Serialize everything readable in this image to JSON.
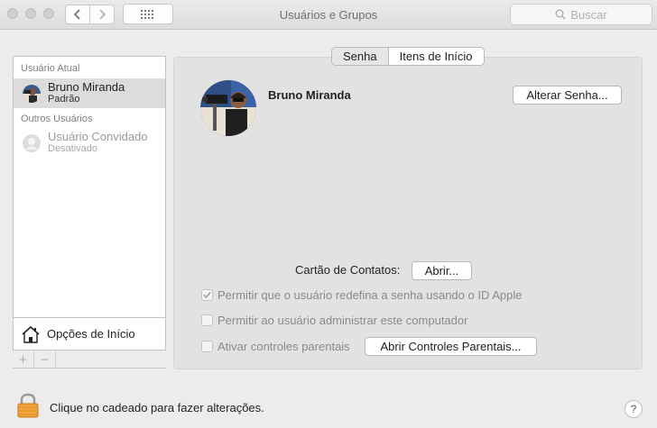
{
  "window": {
    "title": "Usuários e Grupos",
    "search_placeholder": "Buscar"
  },
  "sidebar": {
    "current_user_header": "Usuário Atual",
    "current_user": {
      "name": "Bruno Miranda",
      "role": "Padrão"
    },
    "other_users_header": "Outros Usuários",
    "guest_user": {
      "name": "Usuário Convidado",
      "status": "Desativado"
    },
    "login_options_label": "Opções de Início",
    "add_label": "+",
    "remove_label": "−"
  },
  "tabs": [
    {
      "label": "Senha",
      "active": true
    },
    {
      "label": "Itens de Início",
      "active": false
    }
  ],
  "main": {
    "user_full_name": "Bruno Miranda",
    "change_password_button": "Alterar Senha...",
    "contacts_card_label": "Cartão de Contatos:",
    "open_button": "Abrir...",
    "allow_reset_label": "Permitir que o usuário redefina a senha usando o ID Apple",
    "allow_reset_checked": true,
    "allow_admin_label": "Permitir ao usuário administrar este computador",
    "allow_admin_checked": false,
    "parental_controls_label": "Ativar controles parentais",
    "parental_controls_checked": false,
    "open_parental_button": "Abrir Controles Parentais..."
  },
  "footer": {
    "lock_text": "Clique no cadeado para fazer alterações.",
    "help_label": "?"
  },
  "icons": [
    "close-light-icon",
    "minimize-light-icon",
    "zoom-light-icon",
    "back-chevron-icon",
    "forward-chevron-icon",
    "show-all-grid-icon",
    "search-icon",
    "user-avatar-icon",
    "guest-avatar-icon",
    "house-icon",
    "lock-icon",
    "help-icon"
  ],
  "colors": {
    "lock": "#f0a43a",
    "selection": "#dcdcdc"
  }
}
